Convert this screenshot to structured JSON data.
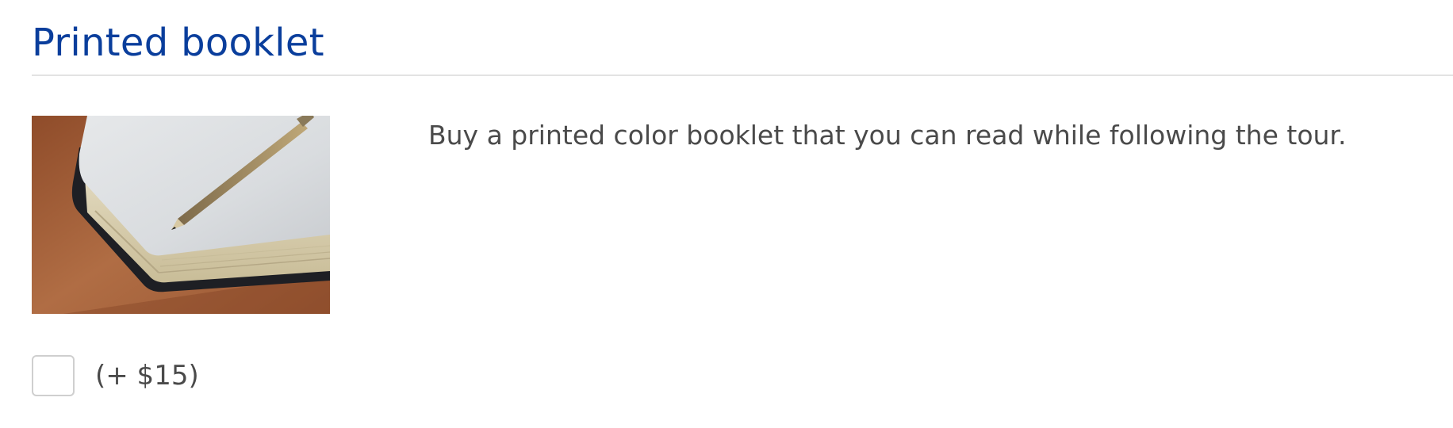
{
  "section": {
    "title": "Printed booklet",
    "description": "Buy a printed color booklet that you can read while following the tour.",
    "image_icon": "notebook-with-pencil-photo"
  },
  "option": {
    "checked": false,
    "price_label": "(+ $15)"
  },
  "colors": {
    "title": "#0a3e9c",
    "text": "#4a4a4a",
    "divider": "#e3e3e3",
    "checkbox_border": "#cfcfcf"
  }
}
